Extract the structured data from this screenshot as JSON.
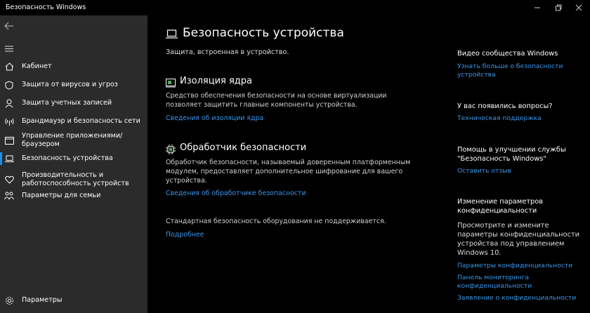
{
  "window": {
    "title": "Безопасность Windows"
  },
  "sidebar": {
    "items": [
      {
        "label": "Кабинет"
      },
      {
        "label": "Защита от вирусов и угроз"
      },
      {
        "label": "Защита учетных записей"
      },
      {
        "label": "Брандмауэр и безопасность сети"
      },
      {
        "label": "Управление приложениями/браузером"
      },
      {
        "label": "Безопасность устройства"
      },
      {
        "label": "Производительность и работоспособность устройств"
      },
      {
        "label": "Параметры для семьи"
      }
    ],
    "settings_label": "Параметры",
    "active": "Безопасность устройства"
  },
  "main": {
    "title": "Безопасность устройства",
    "subtitle": "Защита, встроенная в устройство.",
    "core_isolation": {
      "title": "Изоляция ядра",
      "text_line1": "Средство обеспечения безопасности на основе виртуализации",
      "text_line2": "позволяет защитить главные компоненты устройства.",
      "link": "Сведения об изоляции ядра"
    },
    "security_processor": {
      "title": "Обработчик безопасности",
      "text_line1": "Обработчик безопасности, называемый доверенным платформенным",
      "text_line2": "модулем, предоставляет дополнительное шифрование для вашего",
      "text_line3": "устройства.",
      "link": "Сведения об обработчике безопасности"
    },
    "hardware_status": {
      "text": "Стандартная безопасность оборудования не поддерживается.",
      "link": "Подробнее"
    }
  },
  "right": {
    "community": {
      "heading": "Видео сообщества Windows",
      "link_line1": "Узнать больше о безопасности",
      "link_line2": "устройства"
    },
    "questions": {
      "heading": "У вас появились вопросы?",
      "link": "Техническая поддержка"
    },
    "improve": {
      "heading_line1": "Помощь в улучшении службы",
      "heading_line2": "\"Безопасность Windows\"",
      "link": "Оставить отзыв"
    },
    "privacy": {
      "heading_line1": "Изменение параметров",
      "heading_line2": "конфиденциальности",
      "text_line1": "Просмотрите и измените",
      "text_line2": "параметры конфиденциальности",
      "text_line3": "устройства под управлением",
      "text_line4": "Windows 10.",
      "link1": "Параметры конфиденциальности",
      "link2_line1": "Панель мониторинга",
      "link2_line2": "конфиденциальности",
      "link3": "Заявление о конфиденциальности"
    }
  },
  "colors": {
    "accent": "#3a95e8",
    "sidebar_bg": "#2b2b2b",
    "main_bg": "#000000",
    "active_indicator": "#1e8de6"
  }
}
